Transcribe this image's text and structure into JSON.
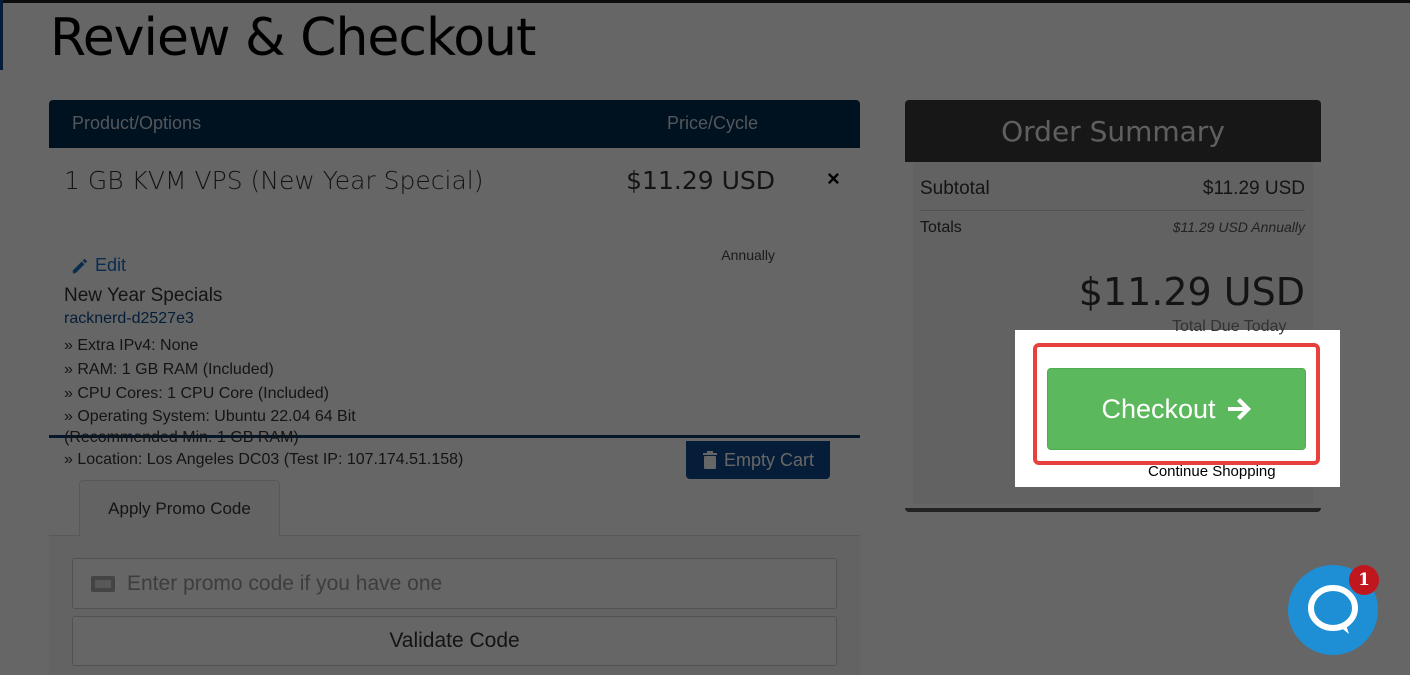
{
  "page": {
    "title": "Review & Checkout"
  },
  "cart": {
    "headers": {
      "product": "Product/Options",
      "price": "Price/Cycle"
    },
    "item": {
      "name": "1 GB KVM VPS (New Year Special)",
      "price": "$11.29 USD",
      "cycle": "Annually",
      "remove": "×",
      "edit_label": "Edit",
      "group": "New Year Specials",
      "hostname": "racknerd-d2527e3",
      "options": [
        "» Extra IPv4: None",
        "» RAM: 1 GB RAM (Included)",
        "» CPU Cores: 1 CPU Core (Included)",
        "» Operating System: Ubuntu 22.04 64 Bit",
        "(Recommended Min. 1 GB RAM)",
        "» Location: Los Angeles DC03 (Test IP: 107.174.51.158)"
      ]
    },
    "empty_cart_label": "Empty Cart"
  },
  "promo": {
    "tab_label": "Apply Promo Code",
    "placeholder": "Enter promo code if you have one",
    "validate_label": "Validate Code"
  },
  "summary": {
    "title": "Order Summary",
    "subtotal_label": "Subtotal",
    "subtotal_value": "$11.29 USD",
    "totals_label": "Totals",
    "totals_value": "$11.29 USD Annually",
    "grand_total": "$11.29 USD",
    "grand_label": "Total Due Today",
    "checkout_label": "Checkout",
    "continue_label": "Continue Shopping"
  },
  "chat": {
    "badge_count": "1",
    "icon": "chat-bubble-icon"
  },
  "colors": {
    "header_navy": "#002b52",
    "checkout_green": "#5cb85c",
    "highlight_red": "#e8403c",
    "chat_blue": "#1e8fd4"
  }
}
